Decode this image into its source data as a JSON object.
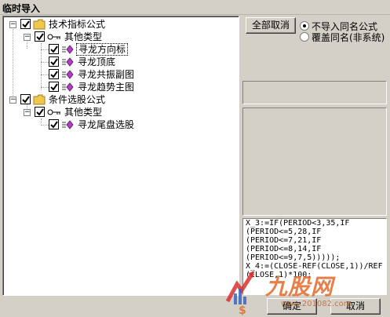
{
  "window": {
    "title": "临时导入"
  },
  "tree": {
    "nodes": [
      {
        "label": "技术指标公式"
      },
      {
        "label": "其他类型"
      },
      {
        "label": "寻龙方向标"
      },
      {
        "label": "寻龙顶底"
      },
      {
        "label": "寻龙共振副图"
      },
      {
        "label": "寻龙趋势主图"
      },
      {
        "label": "条件选股公式"
      },
      {
        "label": "其他类型"
      },
      {
        "label": "寻龙尾盘选股"
      }
    ]
  },
  "buttons": {
    "deselect_all": "全部取消",
    "ok": "确定",
    "cancel": "取消"
  },
  "options": {
    "no_import_same": "不导入同名公式",
    "overwrite_same": "覆盖同名(非系统)",
    "selected": "no_import_same"
  },
  "code_lines": [
    "X_3:=IF(PERIOD<3,35,IF",
    "(PERIOD<=5,28,IF",
    "(PERIOD<=7,21,IF",
    "(PERIOD<=8,14,IF",
    "(PERIOD<=9,7,5)))));",
    "X_4:=(CLOSE-REF(CLOSE,1))/REF",
    "(CLOSE,1)*100;"
  ],
  "watermark": {
    "brand": "九股网",
    "url": "www.201082.com"
  },
  "colors": {
    "folder": "#f0c850",
    "formula_icon": "#b040c0",
    "code_text": "#000000",
    "watermark": "#e06a2a"
  },
  "icons": [
    "folder-icon",
    "key-icon",
    "formula-icon",
    "check-icon"
  ]
}
